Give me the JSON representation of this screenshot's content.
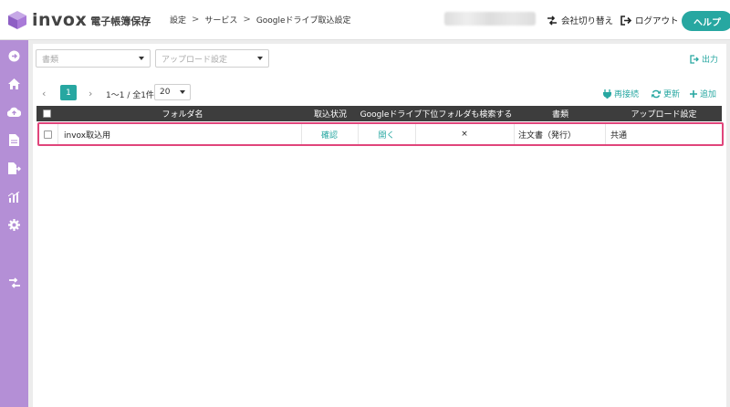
{
  "brand": {
    "name": "invox",
    "subtitle": "電子帳簿保存"
  },
  "breadcrumb": {
    "items": [
      "設定",
      "サービス",
      "Googleドライブ取込設定"
    ],
    "separator": ">"
  },
  "header": {
    "switch_company": "会社切り替え",
    "logout": "ログアウト",
    "help": "ヘルプ"
  },
  "filters": {
    "doc_type_placeholder": "書類",
    "upload_setting_placeholder": "アップロード設定"
  },
  "export_label": "出力",
  "pagination": {
    "current_page": "1",
    "range_text": "1〜1 / 全1件",
    "per_page": "20"
  },
  "toolbar": {
    "reconnect": "再接続",
    "refresh": "更新",
    "add": "追加"
  },
  "table": {
    "columns": [
      "フォルダ名",
      "取込状況",
      "Googleドライブ下位フォルダも検索する",
      "書類",
      "アップロード設定"
    ],
    "rows": [
      {
        "folder": "invox取込用",
        "status": "確認",
        "open": "開く",
        "subfolders": "×",
        "doc_type": "注文書（発行）",
        "upload_setting": "共通"
      }
    ]
  },
  "colors": {
    "accent": "#27a7a1",
    "sidebar": "#b48fd6",
    "highlight": "#e0457b",
    "table_header": "#3d3d3d"
  }
}
